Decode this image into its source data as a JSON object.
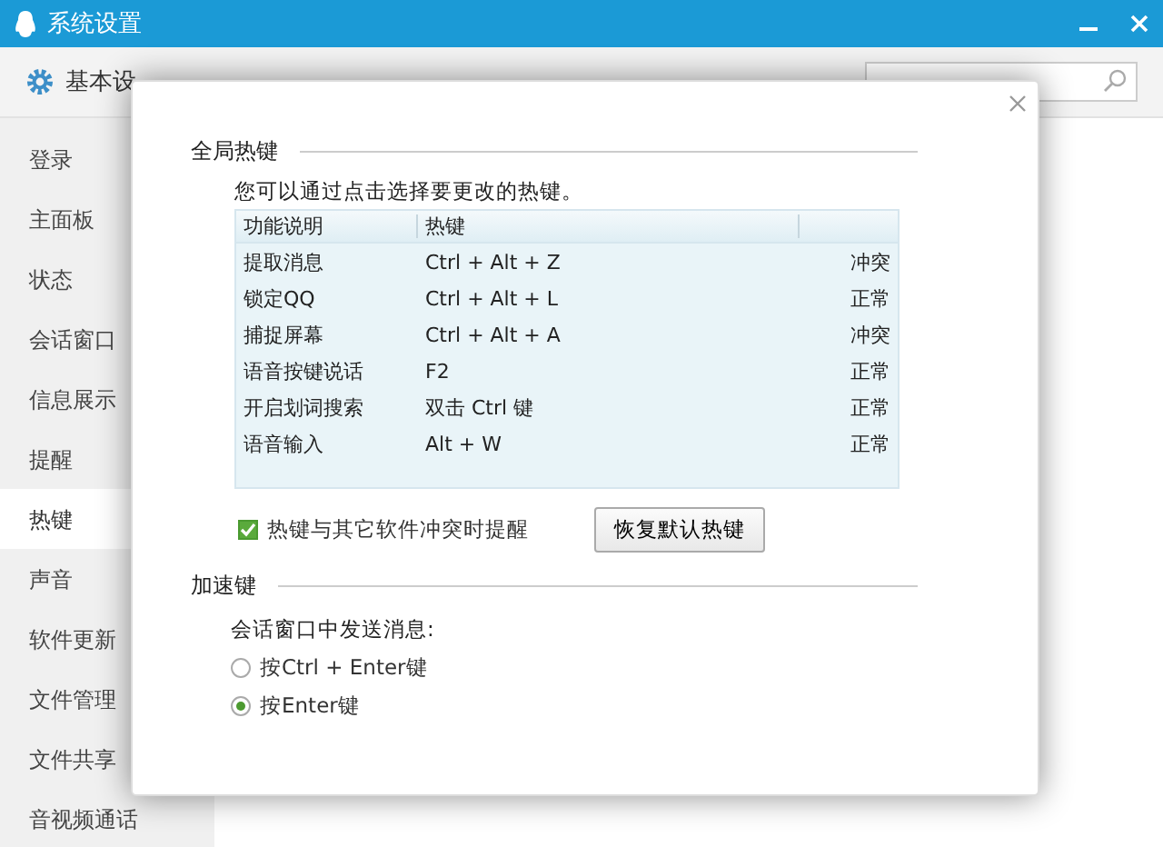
{
  "window": {
    "title": "系统设置"
  },
  "tabs": [
    {
      "label": "基本设",
      "selected": true
    }
  ],
  "sidebar": {
    "items": [
      {
        "label": "登录",
        "selected": false
      },
      {
        "label": "主面板",
        "selected": false
      },
      {
        "label": "状态",
        "selected": false
      },
      {
        "label": "会话窗口",
        "selected": false
      },
      {
        "label": "信息展示",
        "selected": false
      },
      {
        "label": "提醒",
        "selected": false
      },
      {
        "label": "热键",
        "selected": true
      },
      {
        "label": "声音",
        "selected": false
      },
      {
        "label": "软件更新",
        "selected": false
      },
      {
        "label": "文件管理",
        "selected": false
      },
      {
        "label": "文件共享",
        "selected": false
      },
      {
        "label": "音视频通话",
        "selected": false
      }
    ]
  },
  "dialog": {
    "global_section": "全局热键",
    "hint": "您可以通过点击选择要更改的热键。",
    "table": {
      "columns": [
        "功能说明",
        "热键"
      ],
      "rows": [
        {
          "function": "提取消息",
          "hotkey": "Ctrl + Alt + Z",
          "status": "冲突"
        },
        {
          "function": "锁定QQ",
          "hotkey": "Ctrl + Alt + L",
          "status": "正常"
        },
        {
          "function": "捕捉屏幕",
          "hotkey": "Ctrl + Alt + A",
          "status": "冲突"
        },
        {
          "function": "语音按键说话",
          "hotkey": "F2",
          "status": "正常"
        },
        {
          "function": "开启划词搜索",
          "hotkey": "双击 Ctrl 键",
          "status": "正常"
        },
        {
          "function": "语音输入",
          "hotkey": "Alt + W",
          "status": "正常"
        }
      ]
    },
    "conflict_alert": {
      "label": "热键与其它软件冲突时提醒",
      "checked": true
    },
    "restore_button": "恢复默认热键",
    "accel_section": "加速键",
    "send_label": "会话窗口中发送消息:",
    "send_options": [
      {
        "label": "按Ctrl + Enter键",
        "selected": false
      },
      {
        "label": "按Enter键",
        "selected": true
      }
    ]
  }
}
